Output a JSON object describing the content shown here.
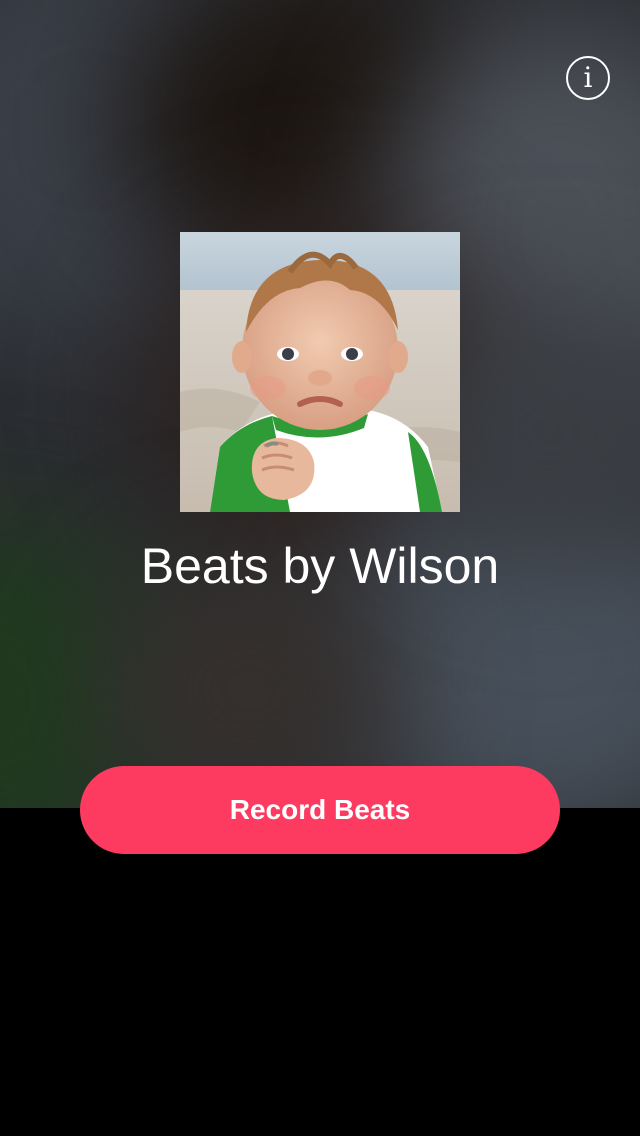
{
  "header": {
    "info_icon": "info-circle-icon",
    "info_glyph": "i"
  },
  "main": {
    "album_art_subject": "baby-fist-photo",
    "title": "Beats by Wilson"
  },
  "actions": {
    "record_label": "Record Beats",
    "record_color": "#fd3b61"
  }
}
